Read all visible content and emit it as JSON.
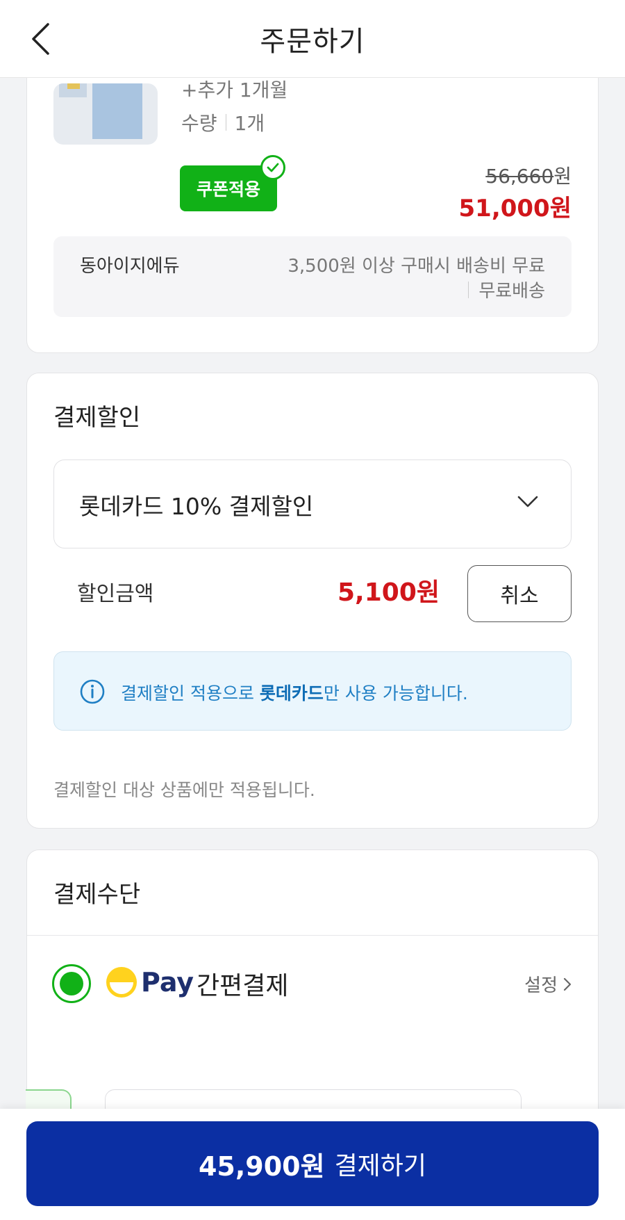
{
  "header": {
    "title": "주문하기"
  },
  "product": {
    "option": "+추가 1개월",
    "quantity_label": "수량",
    "quantity_value": "1개",
    "coupon_badge": "쿠폰적용",
    "original_price": "56,660",
    "original_price_unit": "원",
    "final_price": "51,000원",
    "seller": "동아이지에듀",
    "shipping_condition": "3,500원 이상 구매시 배송비 무료",
    "shipping_fee": "무료배송"
  },
  "payment_discount": {
    "title": "결제할인",
    "selected_option": "롯데카드 10% 결제할인",
    "amount_label": "할인금액",
    "amount_value": "5,100원",
    "cancel_label": "취소",
    "notice_prefix": "결제할인 적용으로 ",
    "notice_highlight": "롯데카드",
    "notice_suffix": "만 사용 가능합니다.",
    "footnote": "결제할인 대상 상품에만 적용됩니다."
  },
  "payment_method": {
    "title": "결제수단",
    "pay_brand": "Pay",
    "method_label": "간편결제",
    "settings_label": "설정"
  },
  "bottom": {
    "amount": "45,900원",
    "label": "결제하기"
  },
  "colors": {
    "accent_green": "#11b117",
    "price_red": "#d0161b",
    "primary_blue": "#0b2fa3",
    "notice_blue": "#1f7fc4"
  }
}
